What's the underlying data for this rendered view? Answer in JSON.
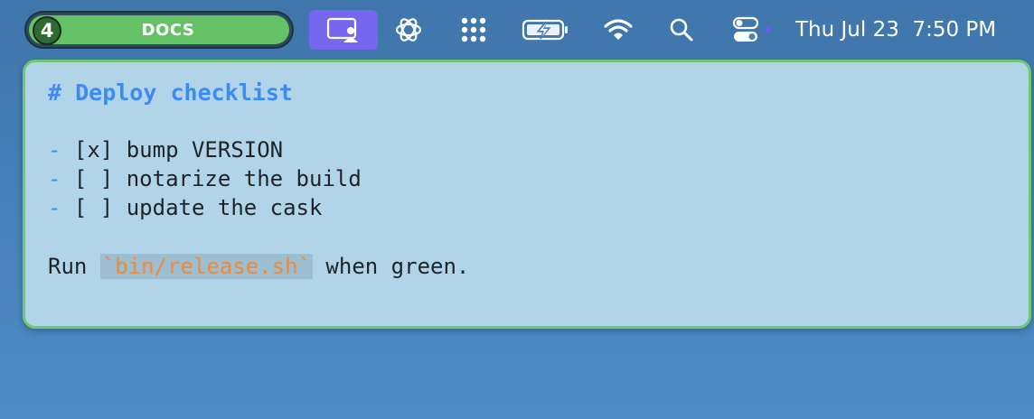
{
  "menubar": {
    "space": {
      "number": "4",
      "label": "DOCS"
    },
    "icons": [
      {
        "name": "screen-share-icon",
        "active": true,
        "color": "#7668ee"
      },
      {
        "name": "chatgpt-icon"
      },
      {
        "name": "app-grid-icon"
      },
      {
        "name": "battery-charging-icon"
      },
      {
        "name": "wifi-icon"
      },
      {
        "name": "spotlight-search-icon"
      },
      {
        "name": "control-center-icon",
        "indicator_color": "#6c5cf0"
      }
    ],
    "clock": "Thu Jul 23  7:50 PM"
  },
  "note": {
    "border_color": "#6fc872",
    "heading": "# Deploy checklist",
    "checklist": [
      {
        "bullet": "-",
        "box": "[x]",
        "text": "bump VERSION"
      },
      {
        "bullet": "-",
        "box": "[ ]",
        "text": "notarize the build"
      },
      {
        "bullet": "-",
        "box": "[ ]",
        "text": "update the cask"
      }
    ],
    "footer": {
      "before": "Run ",
      "code": "`bin/release.sh`",
      "after": " when green."
    }
  },
  "colors": {
    "heading": "#3d8bf2",
    "code": "#f08b3a",
    "space_pill": "#66c266"
  }
}
